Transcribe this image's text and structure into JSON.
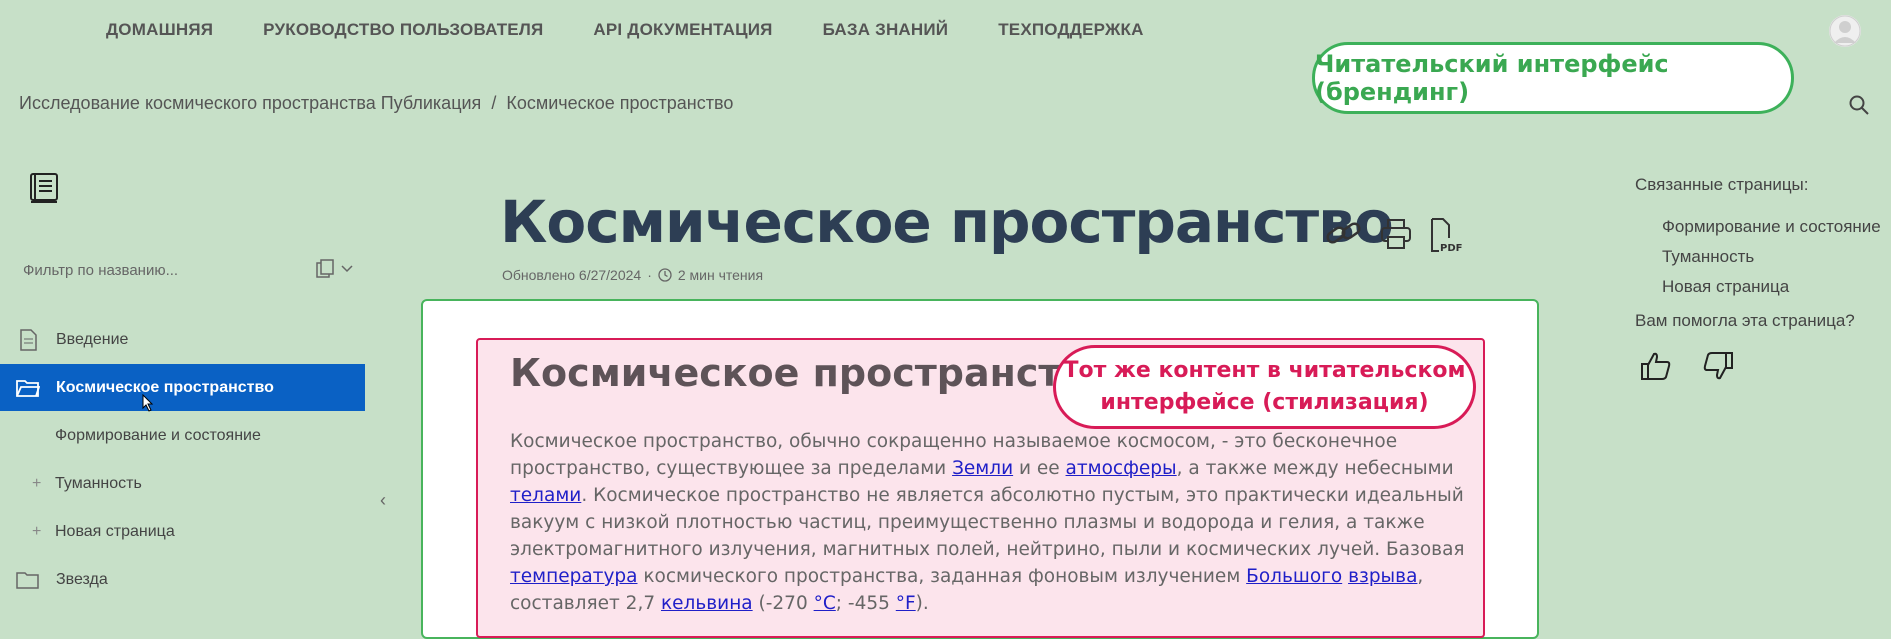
{
  "topnav": {
    "items": [
      {
        "label": "ДОМАШНЯЯ"
      },
      {
        "label": "РУКОВОДСТВО ПОЛЬЗОВАТЕЛЯ"
      },
      {
        "label": "API ДОКУМЕНТАЦИЯ"
      },
      {
        "label": "БАЗА ЗНАНИЙ"
      },
      {
        "label": "ТЕХПОДДЕРЖКА"
      }
    ]
  },
  "annotations": {
    "branding": "Читательский интерфейс (брендинг)",
    "styling_line1": "Тот же контент в читательском",
    "styling_line2": "интерфейсе (стилизация)"
  },
  "breadcrumb": {
    "parent": "Исследование космического пространства Публикация",
    "separator": "/",
    "current": "Космическое пространство"
  },
  "sidebar": {
    "filter_placeholder": "Фильтр по названию...",
    "items": [
      {
        "label": "Введение"
      },
      {
        "label": "Космическое пространство"
      },
      {
        "label": "Формирование и состояние"
      },
      {
        "label": "Туманность"
      },
      {
        "label": "Новая страница"
      },
      {
        "label": "Звезда"
      }
    ],
    "collapse_glyph": "‹"
  },
  "page": {
    "title": "Космическое пространство",
    "updated": "Обновлено 6/27/2024",
    "dot": "·",
    "read_time": "2 мин чтения"
  },
  "content": {
    "title": "Космическое пространство",
    "p1": "Космическое пространство, обычно сокращенно называемое космосом, - это бесконечное пространство, существующее за пределами ",
    "link_earth": "Земли",
    "p2": " и ее ",
    "link_atmo": "атмосферы",
    "p3": ", а также между небесными ",
    "link_bodies": "телами",
    "p4": ". Космическое пространство не является абсолютно пустым, это практически идеальный вакуум с низкой плотностью частиц, преимущественно плазмы и водорода и гелия, а также электромагнитного излучения, магнитных полей, нейтрино, пыли и космических лучей. Базовая ",
    "link_temp": "температура",
    "p5": " космического пространства, заданная фоновым излучением ",
    "link_big": "Большого",
    "p6": " ",
    "link_bang": "взрыва",
    "p7": ", составляет 2,7 ",
    "link_kelvin": "кельвина",
    "p8": " (-270 ",
    "link_c": "°C",
    "p9": "; -455 ",
    "link_f": "°F",
    "p10": ")."
  },
  "related": {
    "title": "Связанные страницы:",
    "items": [
      {
        "label": "Формирование и состояние"
      },
      {
        "label": "Туманность"
      },
      {
        "label": "Новая страница"
      }
    ],
    "helpful": "Вам помогла эта страница?"
  },
  "icons": {
    "link": "link-icon",
    "print": "print-icon",
    "pdf": "pdf-icon",
    "search": "search-icon",
    "book": "book-icon",
    "avatar": "avatar-icon",
    "thumbs_up": "thumbs-up-icon",
    "thumbs_down": "thumbs-down-icon"
  },
  "colors": {
    "background": "#c7e0c8",
    "active": "#0a61c4",
    "branding_accent": "#3aa851",
    "styling_accent": "#d81b57",
    "title": "#2d3e54",
    "link": "#1f1fc8"
  }
}
